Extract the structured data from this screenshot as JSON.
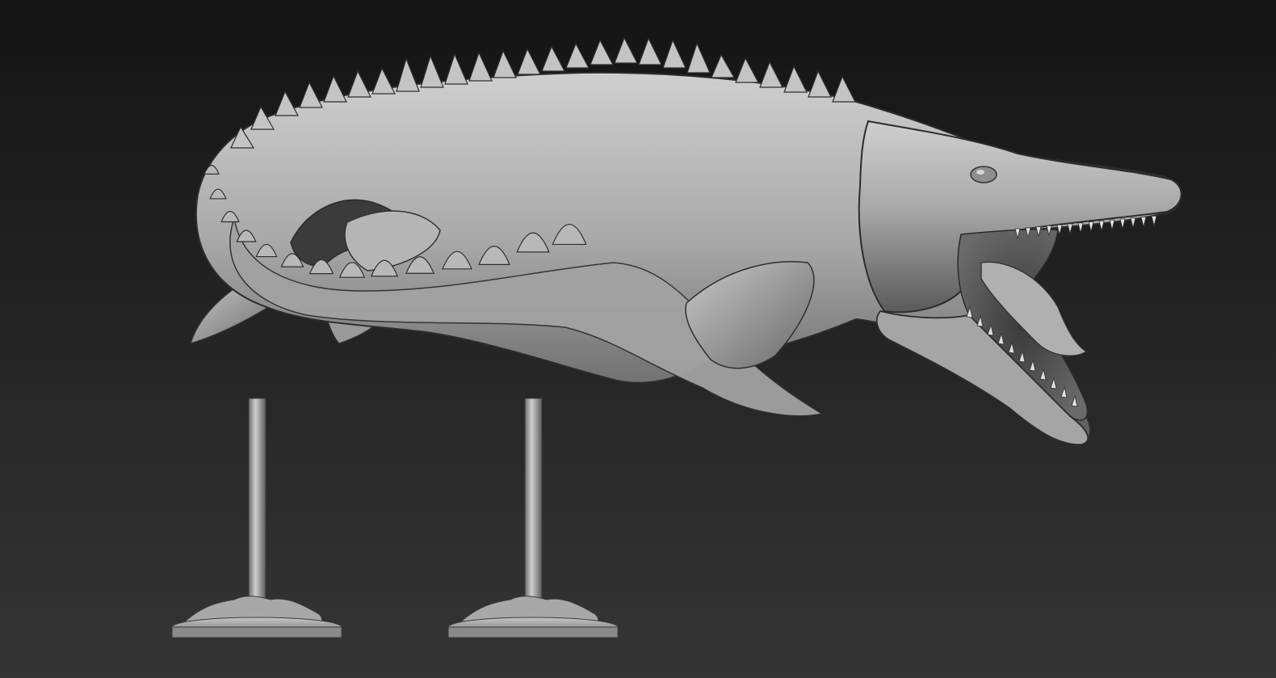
{
  "viewport": {
    "background_top": "#141414",
    "background_bottom": "#353535",
    "model_base": "#9a9a9a",
    "model_light": "#d8d8d8",
    "model_dark": "#4a4a4a",
    "model_outline": "#2a2a2a"
  },
  "model": {
    "subject": "mosasaur sculpt",
    "parts": [
      "body",
      "tail",
      "dorsal-spikes",
      "front-flipper",
      "rear-flipper",
      "head",
      "open-jaw",
      "teeth"
    ]
  },
  "stands": [
    {
      "name": "stand-left"
    },
    {
      "name": "stand-right"
    }
  ]
}
